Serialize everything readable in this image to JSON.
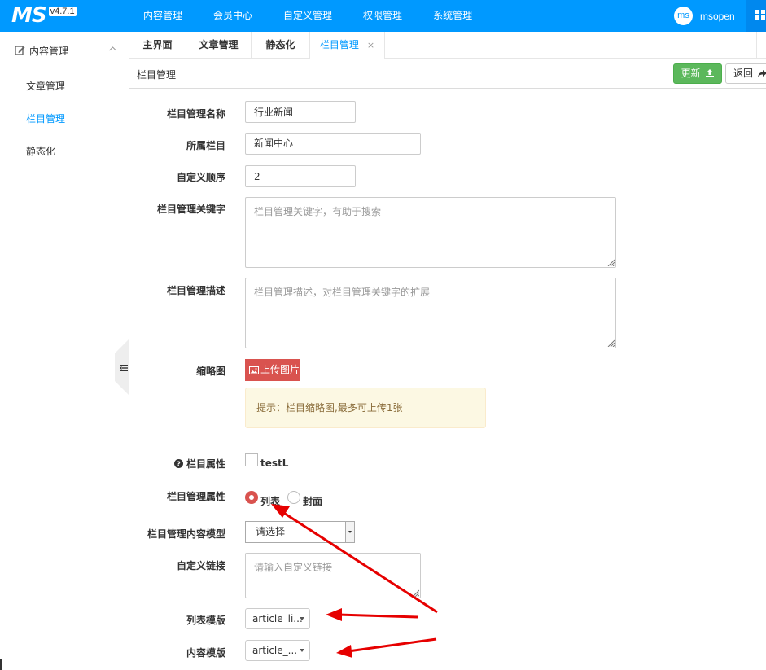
{
  "app": {
    "logo": "MS",
    "version": "v4.7.1"
  },
  "topnav": [
    "内容管理",
    "会员中心",
    "自定义管理",
    "权限管理",
    "系统管理"
  ],
  "user": {
    "avatar": "ms",
    "name": "msopen"
  },
  "sidebar": {
    "group": "内容管理",
    "items": [
      {
        "label": "文章管理"
      },
      {
        "label": "栏目管理"
      },
      {
        "label": "静态化"
      }
    ]
  },
  "tabs": [
    {
      "label": "主界面"
    },
    {
      "label": "文章管理"
    },
    {
      "label": "静态化"
    },
    {
      "label": "栏目管理",
      "close": "×"
    }
  ],
  "header": {
    "title": "栏目管理",
    "update": "更新",
    "back": "返回"
  },
  "form": {
    "name": {
      "label": "栏目管理名称",
      "value": "行业新闻"
    },
    "parent": {
      "label": "所属栏目",
      "value": "新闻中心"
    },
    "order": {
      "label": "自定义顺序",
      "value": "2"
    },
    "keywords": {
      "label": "栏目管理关键字",
      "placeholder": "栏目管理关键字，有助于搜索"
    },
    "description": {
      "label": "栏目管理描述",
      "placeholder": "栏目管理描述，对栏目管理关键字的扩展"
    },
    "thumbnail": {
      "label": "缩略图",
      "button": "上传图片",
      "tip": "提示：栏目缩略图,最多可上传1张"
    },
    "attribute": {
      "label": "栏目属性",
      "option": "testL"
    },
    "type": {
      "label": "栏目管理属性",
      "options": [
        "列表",
        "封面"
      ],
      "selected": "列表"
    },
    "model": {
      "label": "栏目管理内容模型",
      "value": "请选择"
    },
    "link": {
      "label": "自定义链接",
      "placeholder": "请输入自定义链接"
    },
    "list_template": {
      "label": "列表模版",
      "value": "article_li..."
    },
    "content_template": {
      "label": "内容模版",
      "value": "article_..."
    }
  },
  "colors": {
    "primary": "#0099ff",
    "success": "#5cb85c",
    "danger": "#d9534f",
    "annotation": "#e60000"
  },
  "icons": [
    "edit-icon",
    "chevron-up-icon",
    "grid-icon",
    "collapse-menu-icon",
    "upload-icon",
    "reply-icon",
    "image-icon",
    "help-circle-icon"
  ]
}
